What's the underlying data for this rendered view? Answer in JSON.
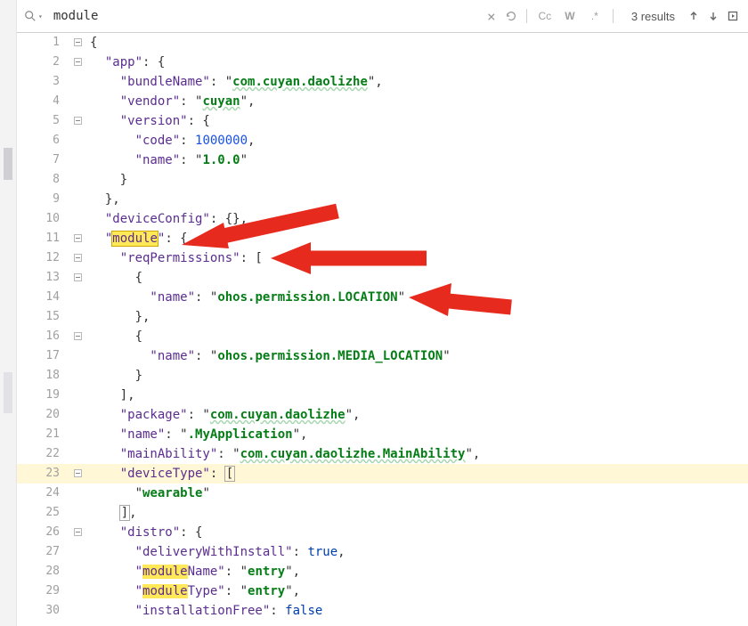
{
  "find": {
    "search_icon": "search",
    "dropdown_icon": "v",
    "query": "module",
    "results_label": "3 results",
    "clear_icon": "×",
    "refresh_icon": "↻",
    "cc_label": "Cc",
    "w_label": "W",
    "regex_label": ".*",
    "up_icon": "↑",
    "down_icon": "↓",
    "expand_icon": "□"
  },
  "code": {
    "l1": "{",
    "l2a": "  \"app\"",
    "l2b": ": {",
    "l3a": "    \"bundleName\"",
    "l3b": ": \"",
    "l3c": "com.cuyan.daolizhe",
    "l3d": "\",",
    "l4a": "    \"vendor\"",
    "l4b": ": \"",
    "l4c": "cuyan",
    "l4d": "\",",
    "l5a": "    \"version\"",
    "l5b": ": {",
    "l6a": "      \"code\"",
    "l6b": ": ",
    "l6c": "1000000",
    "l6d": ",",
    "l7a": "      \"name\"",
    "l7b": ": \"",
    "l7c": "1.0.0",
    "l7d": "\"",
    "l8": "    }",
    "l9": "  },",
    "l10a": "  \"deviceConfig\"",
    "l10b": ": {}",
    "l10c": ",",
    "l11a": "  \"",
    "l11m": "module",
    "l11b": "\"",
    "l11c": ": {",
    "l12a": "    \"reqPermissions\"",
    "l12b": ": [",
    "l13": "      {",
    "l14a": "        \"name\"",
    "l14b": ": \"",
    "l14c": "ohos.permission.LOCATION",
    "l14d": "\"",
    "l15": "      },",
    "l16": "      {",
    "l17a": "        \"name\"",
    "l17b": ": \"",
    "l17c": "ohos.permission.MEDIA_LOCATION",
    "l17d": "\"",
    "l18": "      }",
    "l19": "    ],",
    "l20a": "    \"package\"",
    "l20b": ": \"",
    "l20c": "com.cuyan.daolizhe",
    "l20d": "\",",
    "l21a": "    \"name\"",
    "l21b": ": \"",
    "l21c": ".MyApplication",
    "l21d": "\",",
    "l22a": "    \"mainAbility\"",
    "l22b": ": \"",
    "l22c": "com.cuyan.daolizhe.MainAbility",
    "l22d": "\",",
    "l23a": "    \"deviceType\"",
    "l23b": ": ",
    "l24a": "      \"",
    "l24c": "wearable",
    "l24d": "\"",
    "l25a": "    ",
    "l25b": ",",
    "l26a": "    \"distro\"",
    "l26b": ": {",
    "l27a": "      \"deliveryWithInstall\"",
    "l27b": ": ",
    "l27c": "true",
    "l27d": ",",
    "l28a": "      \"",
    "l28m": "module",
    "l28b": "Name\"",
    "l28c": ": \"",
    "l28d": "entry",
    "l28e": "\",",
    "l29a": "      \"",
    "l29m": "module",
    "l29b": "Type\"",
    "l29c": ": \"",
    "l29d": "entry",
    "l29e": "\",",
    "l30a": "      \"installationFree\"",
    "l30b": ": ",
    "l30c": "false"
  },
  "line_numbers": {
    "n1": "1",
    "n2": "2",
    "n3": "3",
    "n4": "4",
    "n5": "5",
    "n6": "6",
    "n7": "7",
    "n8": "8",
    "n9": "9",
    "n10": "10",
    "n11": "11",
    "n12": "12",
    "n13": "13",
    "n14": "14",
    "n15": "15",
    "n16": "16",
    "n17": "17",
    "n18": "18",
    "n19": "19",
    "n20": "20",
    "n21": "21",
    "n22": "22",
    "n23": "23",
    "n24": "24",
    "n25": "25",
    "n26": "26",
    "n27": "27",
    "n28": "28",
    "n29": "29",
    "n30": "30"
  },
  "colors": {
    "arrow": "#e62b1e"
  }
}
